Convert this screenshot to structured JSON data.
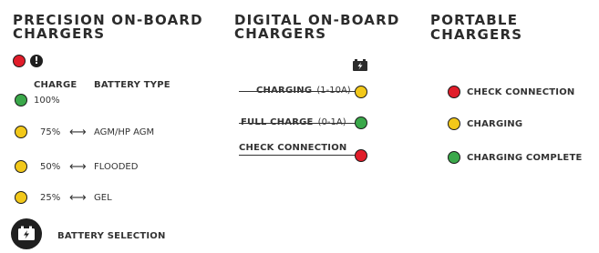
{
  "precision": {
    "title_line1": "PRECISION ON-BOARD",
    "title_line2": "CHARGERS",
    "header_charge": "CHARGE",
    "header_battery_type": "BATTERY TYPE",
    "rows": [
      {
        "pct": "100%",
        "arrow": "",
        "type": "",
        "color": "green"
      },
      {
        "pct": "75%",
        "arrow": "⟷",
        "type": "AGM/HP AGM",
        "color": "yellow"
      },
      {
        "pct": "50%",
        "arrow": "⟷",
        "type": "FLOODED",
        "color": "yellow"
      },
      {
        "pct": "25%",
        "arrow": "⟷",
        "type": "GEL",
        "color": "yellow"
      }
    ],
    "battery_selection": "BATTERY SELECTION"
  },
  "digital": {
    "title_line1": "DIGITAL ON-BOARD",
    "title_line2": "CHARGERS",
    "charging_bold": "CHARGING",
    "charging_range": "(1-10A)",
    "full_bold": "FULL CHARGE",
    "full_range": "(0-1A)",
    "check": "CHECK CONNECTION"
  },
  "portable": {
    "title": "PORTABLE CHARGERS",
    "check": "CHECK CONNECTION",
    "charging": "CHARGING",
    "complete": "CHARGING COMPLETE"
  },
  "colors": {
    "green": "#3aa84a",
    "yellow": "#f2c81a",
    "red": "#e11d2a",
    "dark": "#2b2b2b"
  },
  "icons": {
    "warning": "exclamation-icon",
    "battery": "battery-charge-icon"
  }
}
